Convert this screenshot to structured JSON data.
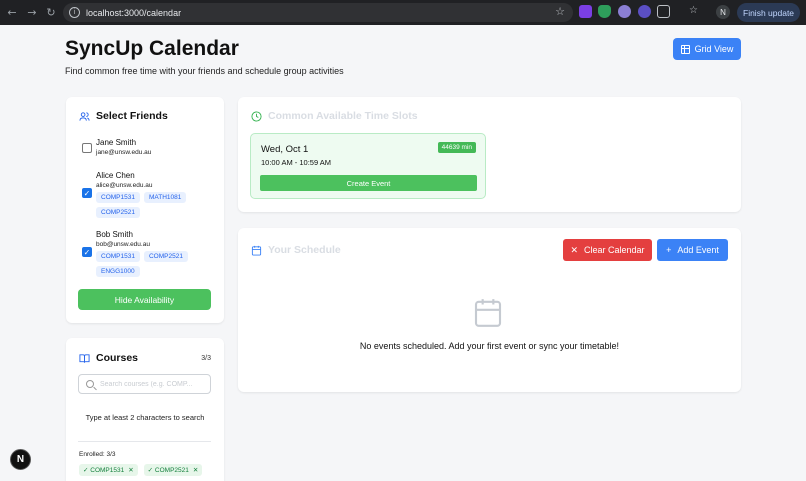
{
  "browser": {
    "url": "localhost:3000/calendar",
    "avatar_initial": "N",
    "update_label": "Finish update"
  },
  "header": {
    "title": "SyncUp Calendar",
    "subtitle": "Find common free time with your friends and schedule group activities",
    "grid_view_label": "Grid View"
  },
  "friends": {
    "heading": "Select Friends",
    "items": [
      {
        "name": "Jane Smith",
        "email": "jane@unsw.edu.au",
        "checked": false,
        "courses": []
      },
      {
        "name": "Alice Chen",
        "email": "alice@unsw.edu.au",
        "checked": true,
        "courses": [
          "COMP1531",
          "MATH1081",
          "COMP2521"
        ]
      },
      {
        "name": "Bob Smith",
        "email": "bob@unsw.edu.au",
        "checked": true,
        "courses": [
          "COMP1531",
          "COMP2521",
          "ENGG1000"
        ]
      }
    ],
    "hide_label": "Hide Availability"
  },
  "courses": {
    "heading": "Courses",
    "count": "3/3",
    "search_placeholder": "Search courses (e.g. COMP...",
    "hint": "Type at least 2 characters to search",
    "enrolled_label": "Enrolled: 3/3",
    "enrolled": [
      "✓ COMP1531",
      "✓ COMP2521"
    ]
  },
  "slots": {
    "heading": "Common Available Time Slots",
    "items": [
      {
        "day": "Wed, Oct 1",
        "time": "10:00 AM - 10:59 AM",
        "duration": "44639 min",
        "action": "Create Event"
      }
    ]
  },
  "schedule": {
    "heading": "Your Schedule",
    "clear_label": "Clear Calendar",
    "add_label": "Add Event",
    "empty_text": "No events scheduled. Add your first event or sync your timetable!"
  },
  "colors": {
    "primary_blue": "#3b82f6",
    "success_green": "#4cc15e",
    "danger_red": "#e43f3f"
  },
  "dev_badge": "N"
}
